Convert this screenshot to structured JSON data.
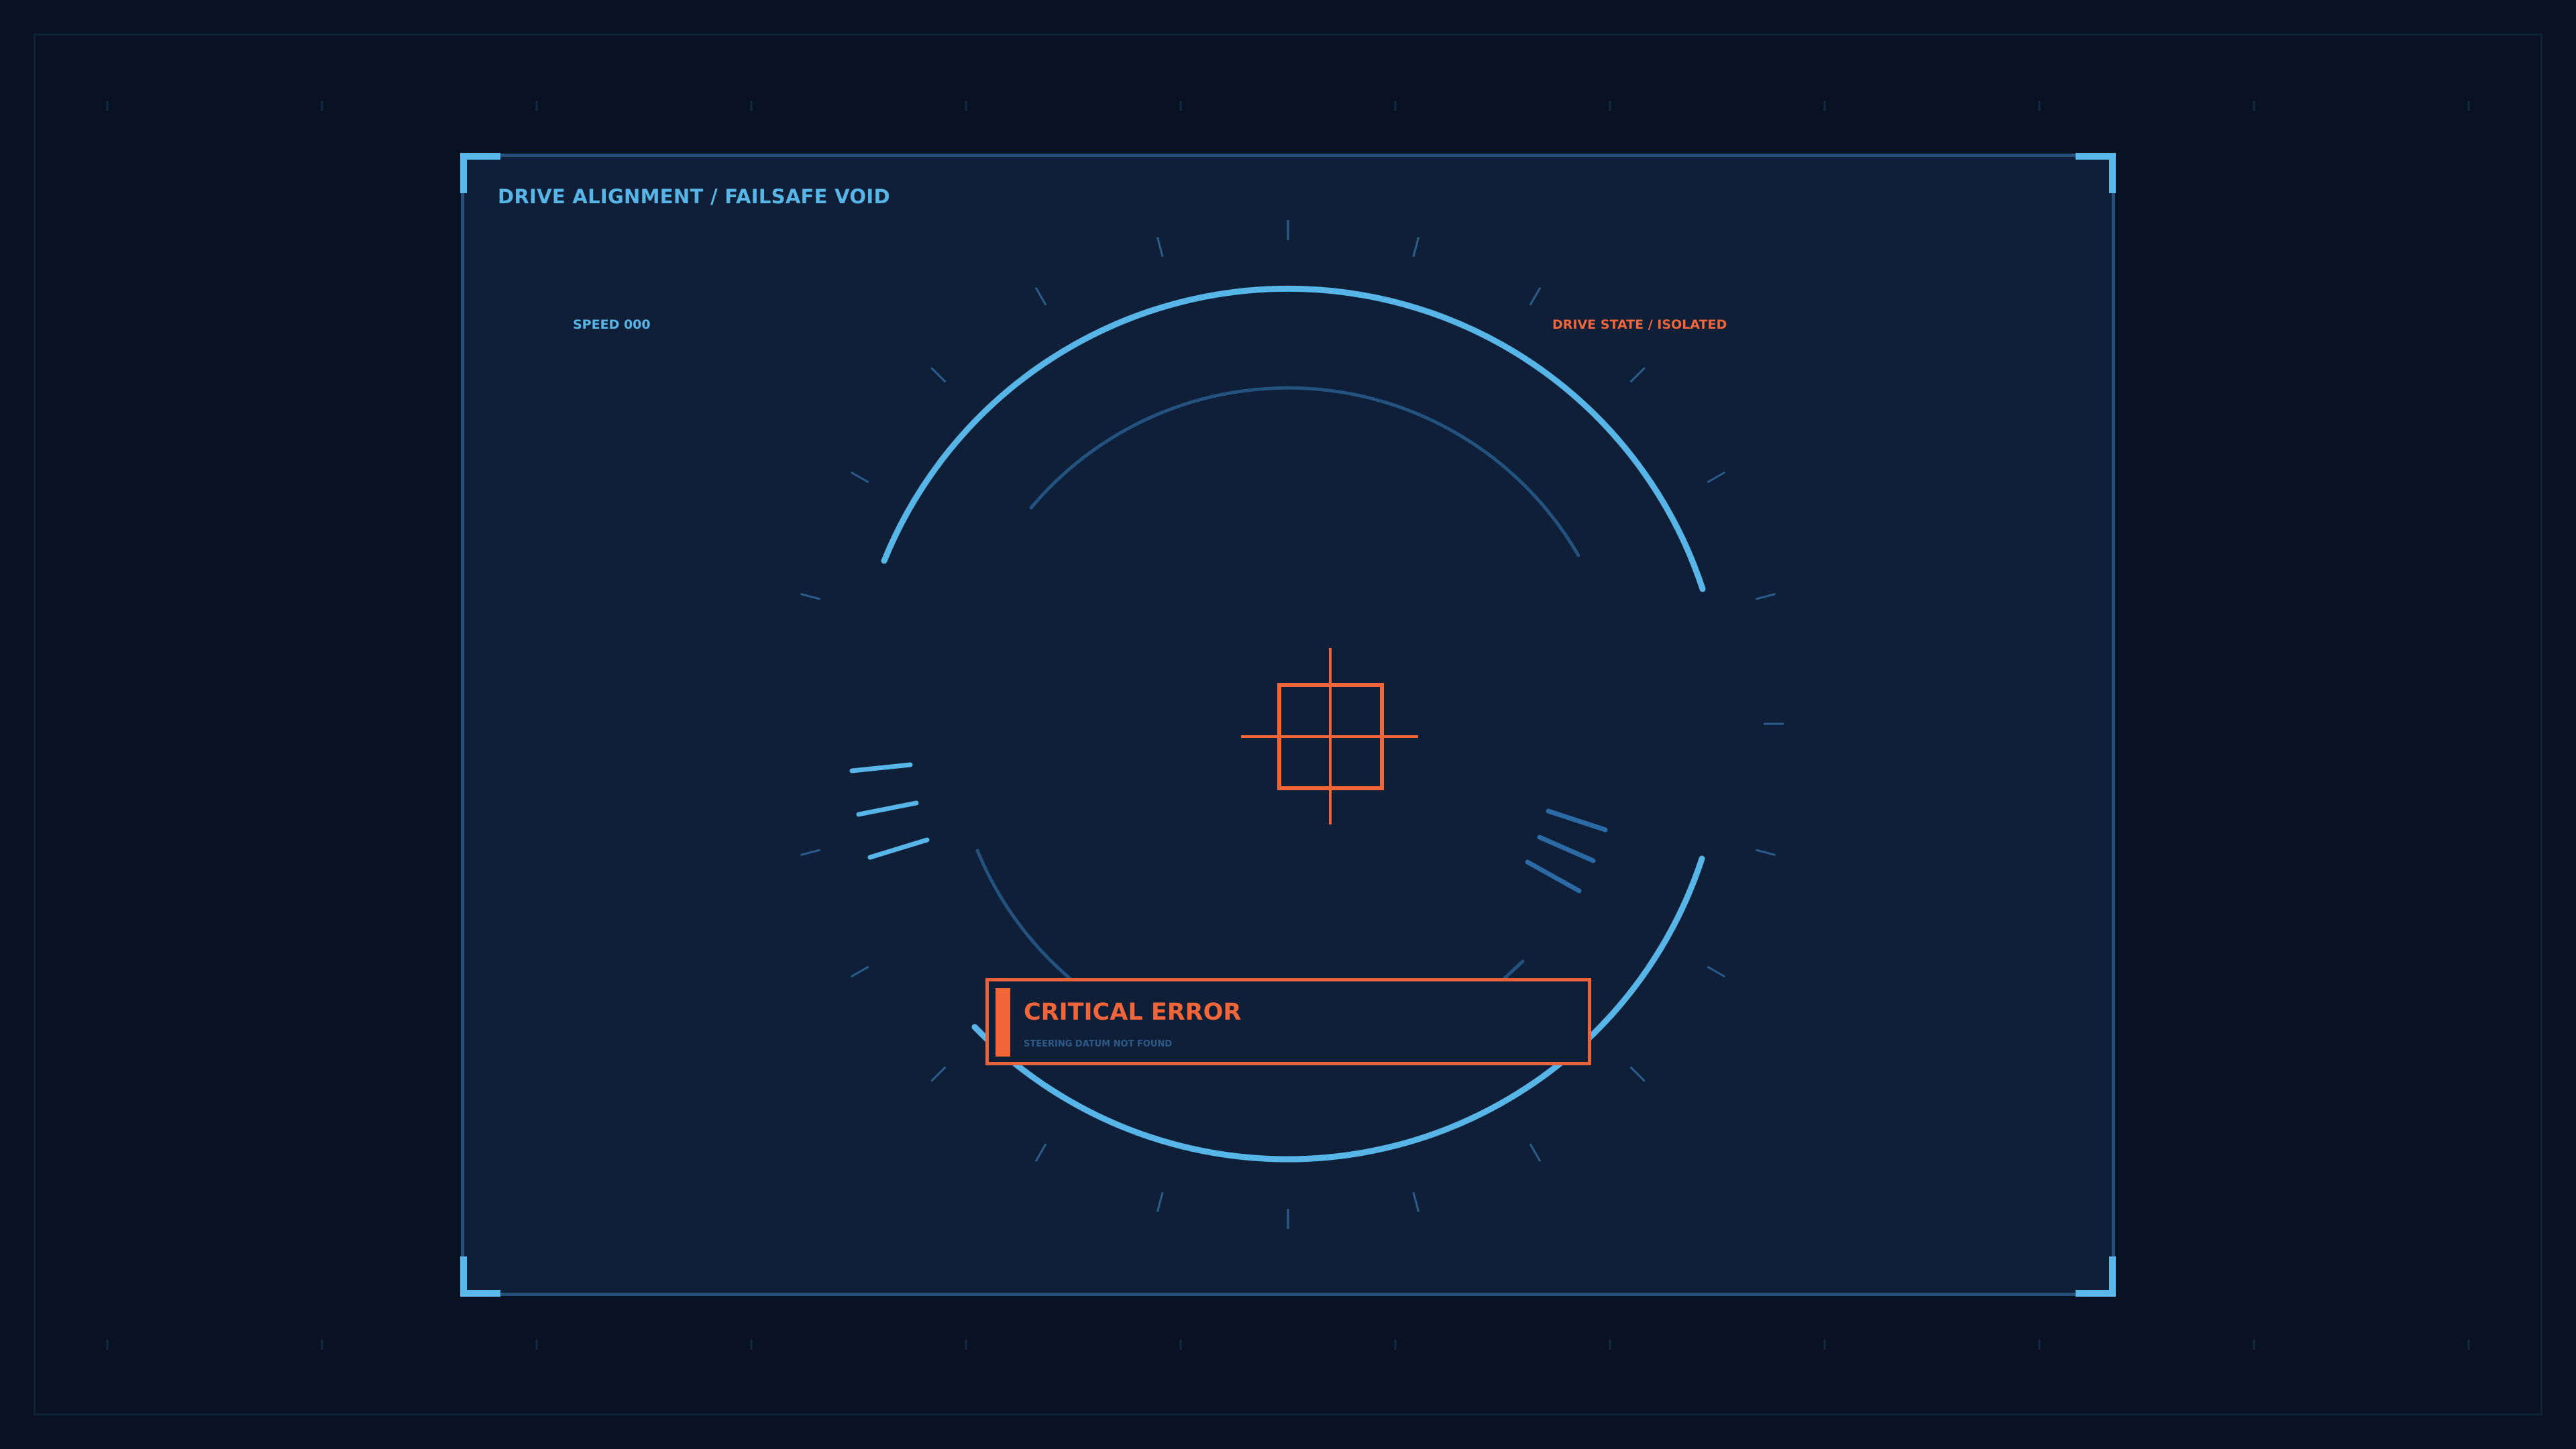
{
  "header": {
    "title": "DRIVE ALIGNMENT / FAILSAFE VOID"
  },
  "readouts": {
    "speed": "SPEED 000",
    "drive_state": "DRIVE STATE / ISOLATED"
  },
  "alert": {
    "title": "CRITICAL ERROR",
    "subtitle": "STEERING DATUM NOT FOUND"
  },
  "colors": {
    "background": "#081223",
    "panel": "#0e1f37",
    "accent_blue": "#58b5e8",
    "dim_blue": "#24507b",
    "alert_orange": "#f0663a"
  },
  "icons": [
    "corner-bracket-icon",
    "crosshair-reticle-icon",
    "alert-marker-icon"
  ]
}
